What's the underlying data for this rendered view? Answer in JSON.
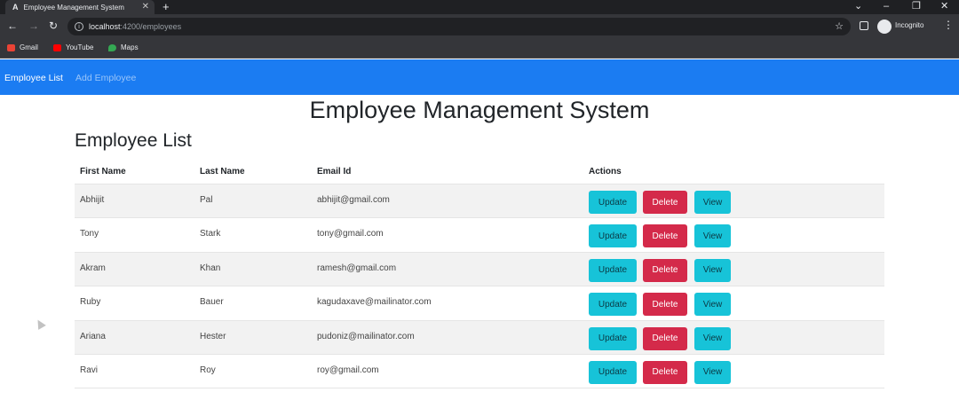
{
  "browser": {
    "tab_title": "Employee Management System",
    "tab_favicon": "A",
    "url_host": "localhost",
    "url_rest": ":4200/employees",
    "profile_label": "Incognito",
    "bookmarks": [
      {
        "label": "Gmail",
        "icon": "gmail-icon",
        "color": "#ea4335"
      },
      {
        "label": "YouTube",
        "icon": "youtube-icon",
        "color": "#ff0000"
      },
      {
        "label": "Maps",
        "icon": "maps-icon",
        "color": "#34a853"
      }
    ]
  },
  "navbar": {
    "brand": "Employee List",
    "link": "Add Employee",
    "color": "#1b7cf2"
  },
  "page_title": "Employee Management System",
  "section_title": "Employee List",
  "table": {
    "headers": [
      "First Name",
      "Last Name",
      "Email Id",
      "Actions"
    ],
    "rows": [
      {
        "first": "Abhijit",
        "last": "Pal",
        "email": "abhijit@gmail.com"
      },
      {
        "first": "Tony",
        "last": "Stark",
        "email": "tony@gmail.com"
      },
      {
        "first": "Akram",
        "last": "Khan",
        "email": "ramesh@gmail.com"
      },
      {
        "first": "Ruby",
        "last": "Bauer",
        "email": "kagudaxave@mailinator.com"
      },
      {
        "first": "Ariana",
        "last": "Hester",
        "email": "pudoniz@mailinator.com"
      },
      {
        "first": "Ravi",
        "last": "Roy",
        "email": "roy@gmail.com"
      }
    ],
    "actions": {
      "update": "Update",
      "delete": "Delete",
      "view": "View"
    }
  },
  "colors": {
    "update": "#17c3d8",
    "delete": "#d42a4a",
    "view": "#17c3d8"
  }
}
